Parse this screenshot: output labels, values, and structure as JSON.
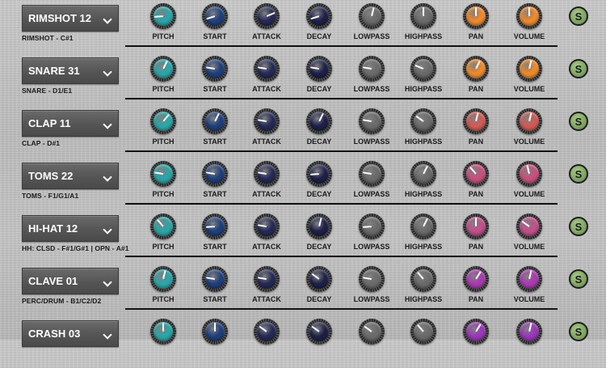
{
  "knob_labels": [
    "PITCH",
    "START",
    "ATTACK",
    "DECAY",
    "LOWPASS",
    "HIGHPASS",
    "PAN",
    "VOLUME"
  ],
  "solo_label": "S",
  "colors": {
    "pitch": "#2aa5a8",
    "start": "#1f3f7a",
    "attack": "#252a55",
    "decay": "#1e2048",
    "filter": "#6a6a6a",
    "solo": "#86a86a"
  },
  "rows": [
    {
      "name": "RIMSHOT 12",
      "sub": "RIMSHOT - C#1",
      "knob_color": "#ef8a2a",
      "values": [
        0.15,
        0.1,
        0.75,
        0.1,
        0.55,
        0.5,
        0.5,
        0.5
      ]
    },
    {
      "name": "SNARE 31",
      "sub": "SNARE - D1/E1",
      "knob_color": "#ef8a2a",
      "values": [
        0.6,
        0.2,
        0.2,
        0.2,
        0.2,
        0.25,
        0.6,
        0.55
      ]
    },
    {
      "name": "CLAP 11",
      "sub": "CLAP - D#1",
      "knob_color": "#d25a56",
      "values": [
        0.65,
        0.6,
        0.2,
        0.6,
        0.2,
        0.3,
        0.55,
        0.55
      ]
    },
    {
      "name": "TOMS 22",
      "sub": "TOMS - F1/G1/A1",
      "knob_color": "#c8507a",
      "values": [
        0.2,
        0.2,
        0.2,
        0.15,
        0.2,
        0.6,
        0.35,
        0.45
      ]
    },
    {
      "name": "HI-HAT 12",
      "sub": "HH: CLSD - F#1/G#1 | OPN - A#1",
      "knob_color": "#c24f8a",
      "values": [
        0.35,
        0.15,
        0.2,
        0.55,
        0.15,
        0.6,
        0.5,
        0.3
      ]
    },
    {
      "name": "CLAVE 01",
      "sub": "PERC/DRUM - B1/C2/D2",
      "knob_color": "#a83ab0",
      "values": [
        0.55,
        0.2,
        0.2,
        0.3,
        0.2,
        0.35,
        0.62,
        0.55
      ]
    },
    {
      "name": "CRASH 03",
      "sub": "",
      "knob_color": "#9a36b8",
      "values": [
        0.5,
        0.5,
        0.3,
        0.3,
        0.3,
        0.35,
        0.62,
        0.55
      ]
    }
  ]
}
